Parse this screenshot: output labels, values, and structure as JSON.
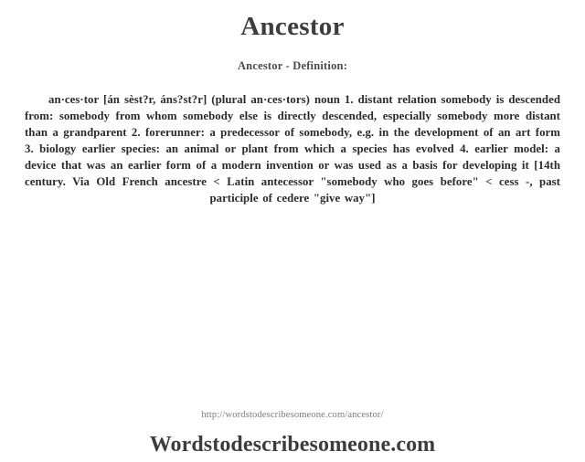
{
  "page": {
    "headword": "Ancestor",
    "subtitle": "Ancestor - Definition:",
    "definition": "an·ces·tor [án sèst?r, áns?st?r] (plural an·ces·tors) noun 1. distant relation somebody is descended from: somebody from whom somebody else is directly descended, especially somebody more distant than a grandparent 2. forerunner: a predecessor of somebody, e.g. in the development of an art form 3. biology earlier species: an animal or plant from which a species has evolved 4. earlier model: a device that was an earlier form of a modern invention or was used as a basis for developing it [14th century. Via Old French ancestre < Latin antecessor \"somebody who goes before\" < cess -, past participle of cedere \"give way\"]",
    "definition_lines": [
      "an·ces·tor [án sèst?r, áns?st?r] (plural an·ces·tors) noun 1. distant relation",
      "somebody is descended from: somebody from whom somebody else is directly",
      "descended, especially somebody more distant than a grandparent 2. forerunner:",
      "a predecessor of somebody, e.g. in the development of an art form 3. biology",
      "earlier species: an animal or plant from which a species has evolved 4. earlier",
      "model: a device that was an earlier form of a modern invention or was used as a",
      "basis for developing it [14th century. Via Old French ancestre < Latin antecessor",
      "\"somebody who goes before\" < cess -, past participle of cedere \"give way\"]"
    ],
    "footer": {
      "url": "http://wordstodescribesomeone.com/ancestor/",
      "brand": "Wordstodescribesomeone.com"
    }
  },
  "colors": {
    "background": "#ffffff",
    "heading": "#3d3d3d",
    "body_text": "#2b2b2b",
    "url_text": "#7b7b7b"
  }
}
